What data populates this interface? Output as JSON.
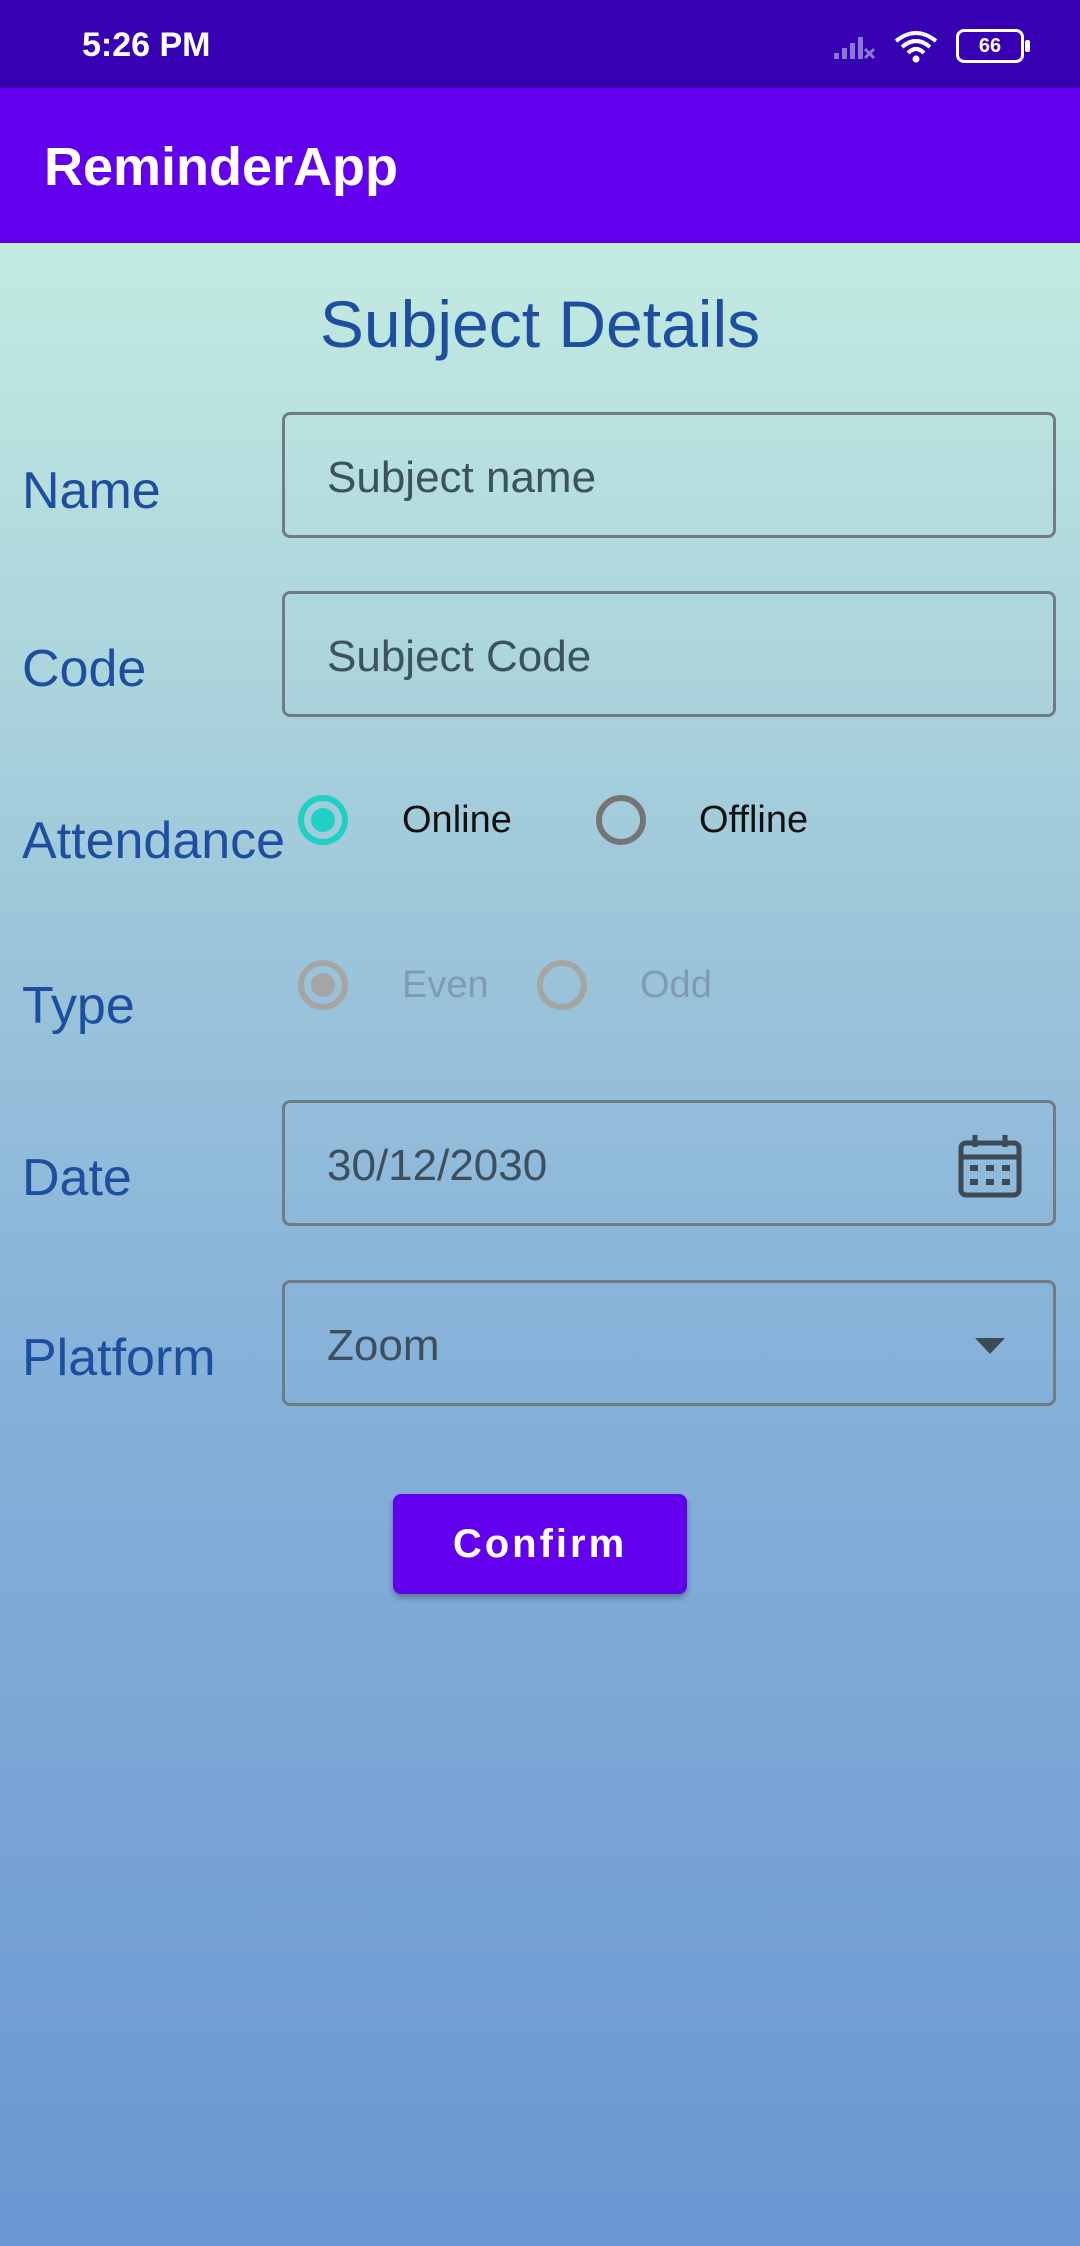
{
  "status_bar": {
    "time": "5:26 PM",
    "battery": "66"
  },
  "app_bar": {
    "title": "ReminderApp"
  },
  "form": {
    "title": "Subject Details",
    "name": {
      "label": "Name",
      "placeholder": "Subject name"
    },
    "code": {
      "label": "Code",
      "placeholder": "Subject Code"
    },
    "attendance": {
      "label": "Attendance",
      "options": [
        "Online",
        "Offline"
      ],
      "selected": "Online"
    },
    "type": {
      "label": "Type",
      "options": [
        "Even",
        "Odd"
      ],
      "selected": "Even",
      "disabled": true
    },
    "date": {
      "label": "Date",
      "value": "30/12/2030"
    },
    "platform": {
      "label": "Platform",
      "value": "Zoom"
    },
    "confirm_label": "Confirm"
  },
  "colors": {
    "status_bar": "#3700b3",
    "app_bar": "#6200ee",
    "accent": "#1fd1c5",
    "label_text": "#1e4ea0"
  }
}
